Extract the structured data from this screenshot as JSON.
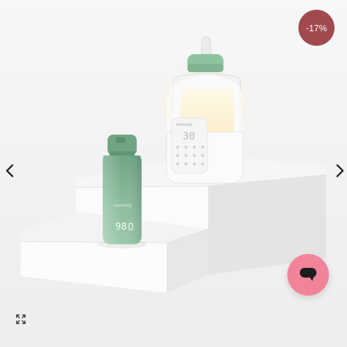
{
  "product_gallery": {
    "discount_badge": "-17%",
    "bottle_display": "98",
    "warmer_display": "30",
    "brand_mark": "momcozy"
  },
  "icons": {
    "prev": "chevron-left-icon",
    "next": "chevron-right-icon",
    "chat": "chat-bubble-icon",
    "expand": "expand-icon"
  },
  "colors": {
    "badge": "#a04a4f",
    "chat_button": "#f2849a",
    "bottle_green": "#7fb08f"
  }
}
